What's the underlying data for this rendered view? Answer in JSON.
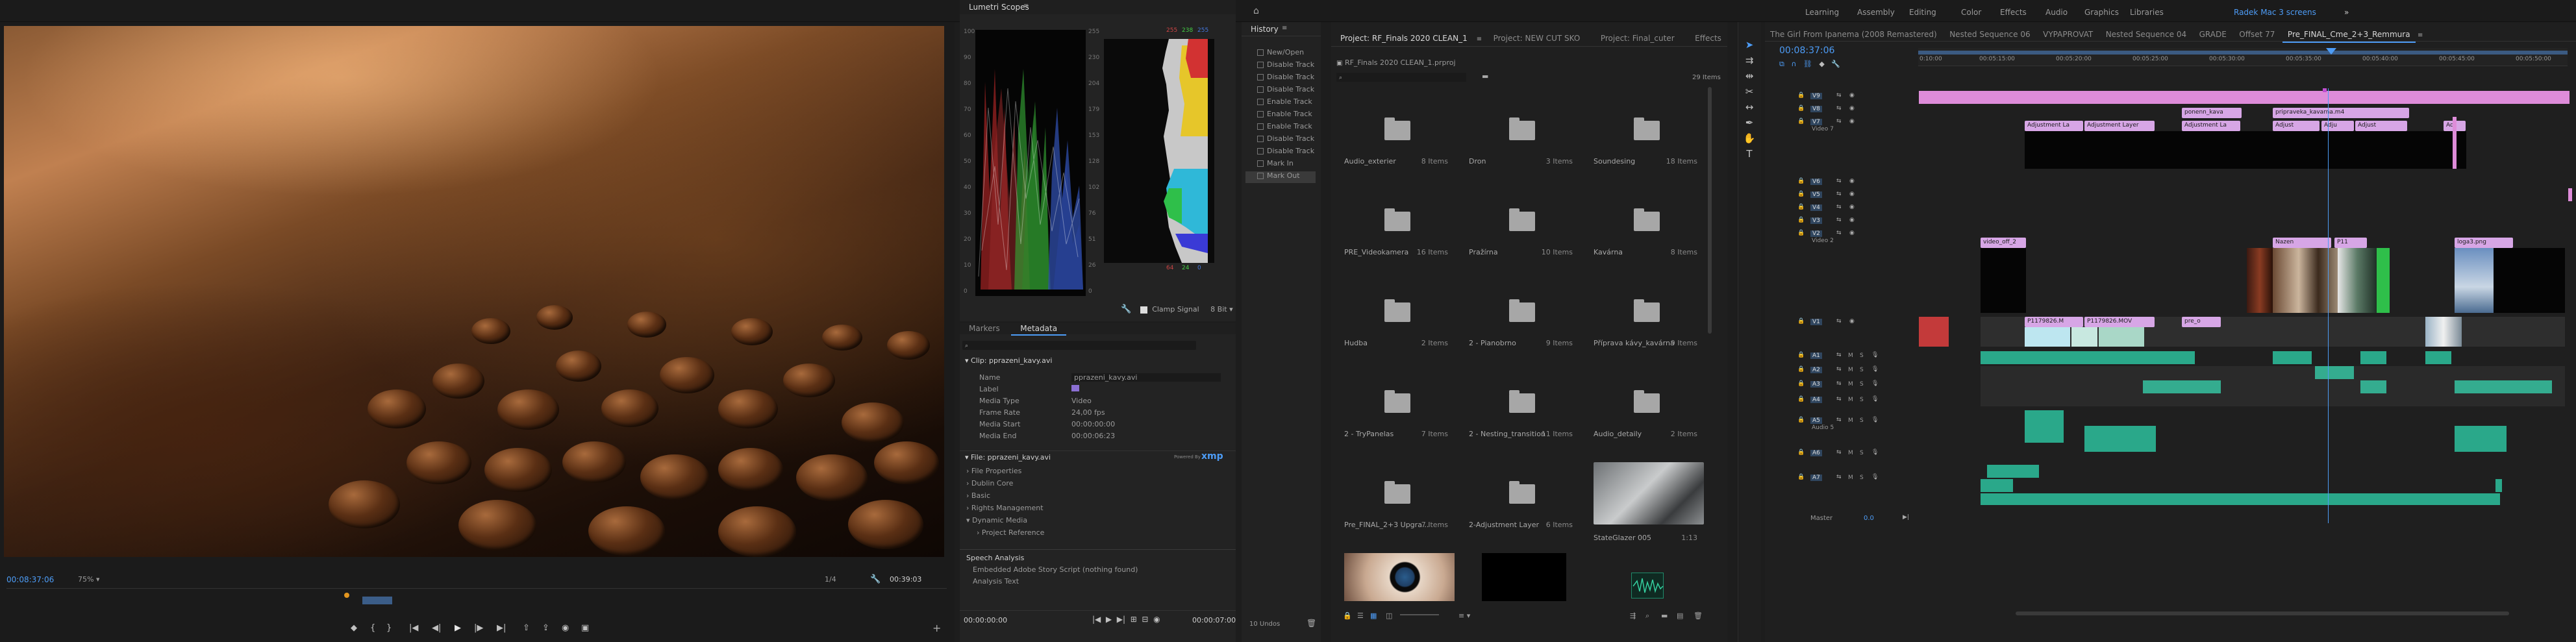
{
  "workspaces": [
    "Learning",
    "Assembly",
    "Editing",
    "Color",
    "Effects",
    "Audio",
    "Graphics",
    "Libraries"
  ],
  "active_workspace": "Radek Mac 3 screens",
  "program_monitor": {
    "timecode": "00:08:37:06",
    "zoom": "75%",
    "resolution": "1/4",
    "duration": "00:39:03"
  },
  "scopes": {
    "tab": "Lumetri Scopes",
    "scale_left": [
      "100",
      "90",
      "80",
      "70",
      "60",
      "50",
      "40",
      "30",
      "20",
      "10",
      "0"
    ],
    "scale_right": [
      "255",
      "230",
      "204",
      "179",
      "153",
      "128",
      "102",
      "76",
      "51",
      "26",
      "0"
    ],
    "hist_top": [
      "255",
      "238",
      "255"
    ],
    "hist_bottom": [
      "64",
      "24",
      "0"
    ],
    "clamp_signal": "Clamp Signal",
    "bit_depth": "8 Bit"
  },
  "metadata_panel": {
    "tabs": [
      "Markers",
      "Metadata"
    ],
    "clip_header": "Clip: pprazeni_kavy.avi",
    "rows": [
      {
        "k": "Name",
        "v": "pprazeni_kavy.avi"
      },
      {
        "k": "Label",
        "v": ""
      },
      {
        "k": "Media Type",
        "v": "Video"
      },
      {
        "k": "Frame Rate",
        "v": "24,00 fps"
      },
      {
        "k": "Media Start",
        "v": "00:00:00:00"
      },
      {
        "k": "Media End",
        "v": "00:00:06:23"
      }
    ],
    "file_header": "File: pprazeni_kavy.avi",
    "xmp_label": "Powered By",
    "xmp": "xmp",
    "sections": [
      "File Properties",
      "Dublin Core",
      "Basic",
      "Rights Management",
      "Dynamic Media"
    ],
    "subsection": "Project Reference",
    "speech": {
      "title": "Speech Analysis",
      "embedded": "Embedded Adobe Story Script (nothing found)",
      "analysis": "Analysis Text"
    },
    "bottom_timecode": "00:00:00:00",
    "bottom_timecode_right": "00:00:07:00"
  },
  "history": {
    "tab": "History",
    "items": [
      "New/Open",
      "Disable Track",
      "Disable Track",
      "Disable Track",
      "Enable Track",
      "Enable Track",
      "Enable Track",
      "Disable Track",
      "Disable Track",
      "Mark In",
      "Mark Out"
    ],
    "undos": "10 Undos"
  },
  "project": {
    "tabs": [
      "Project: RF_Finals 2020 CLEAN_1",
      "Project: NEW CUT SKO",
      "Project: Final_cuter",
      "Effects"
    ],
    "path": "RF_Finals 2020 CLEAN_1.prproj",
    "item_count": "29 Items",
    "bins": [
      {
        "name": "Audio_exterier",
        "count": "8 Items"
      },
      {
        "name": "Dron",
        "count": "3 Items"
      },
      {
        "name": "Soundesing",
        "count": "18 Items"
      },
      {
        "name": "PRE_Videokamera",
        "count": "16 Items"
      },
      {
        "name": "Pražírna",
        "count": "10 Items"
      },
      {
        "name": "Kavárna",
        "count": "8 Items"
      },
      {
        "name": "Hudba",
        "count": "2 Items"
      },
      {
        "name": "2 - Pianobrno",
        "count": "9 Items"
      },
      {
        "name": "Příprava kávy_kavárna",
        "count": "9 Items"
      },
      {
        "name": "2 - TryPanelas",
        "count": "7 Items"
      },
      {
        "name": "2 - Nesting_transition",
        "count": "11 Items"
      },
      {
        "name": "Audio_detaily",
        "count": "2 Items"
      },
      {
        "name": "Pre_FINAL_2+3 Upgra...",
        "count": "7 Items"
      },
      {
        "name": "2-Adjustment Layer",
        "count": "6 Items"
      },
      {
        "name": "StateGlazer 005",
        "count": "1:13"
      }
    ]
  },
  "timeline": {
    "tabs": [
      "The Girl From Ipanema (2008 Remastered)",
      "Nested Sequence 06",
      "VYPAPROVAT",
      "Nested Sequence 04",
      "GRADE",
      "Offset 77",
      "Pre_FINAL_Cme_2+3_Remmura"
    ],
    "timecode": "00:08:37:06",
    "ruler": [
      "0:10:00",
      "00:05:15:00",
      "00:05:20:00",
      "00:05:25:00",
      "00:05:30:00",
      "00:05:35:00",
      "00:05:40:00",
      "00:05:45:00",
      "00:05:50:00"
    ],
    "video_tracks": [
      "V9",
      "V8",
      "V7",
      "V6",
      "V5",
      "V4",
      "V3",
      "V2",
      "V1"
    ],
    "video_labels": {
      "V7": "Video 7",
      "V2": "Video 2"
    },
    "audio_tracks": [
      "A1",
      "A2",
      "A3",
      "A4",
      "A5",
      "A6",
      "A7"
    ],
    "audio_labels": {
      "A5": "Audio 5"
    },
    "master": "Master",
    "master_value": "0.0",
    "clips": {
      "top": [
        "Adjustment La",
        "Adjustment Layer",
        "Adjustment La",
        "Adjust",
        "Adju",
        "Adjust",
        "Ad"
      ],
      "upper": [
        "ponenn_kava",
        "pripraveka_kavarna.m4"
      ],
      "v2": [
        "video_off_2",
        "Nazen",
        "P11",
        "loga3.png"
      ],
      "v1": [
        "P1179826.M",
        "P1179826.MOV",
        "pre_o"
      ]
    }
  }
}
